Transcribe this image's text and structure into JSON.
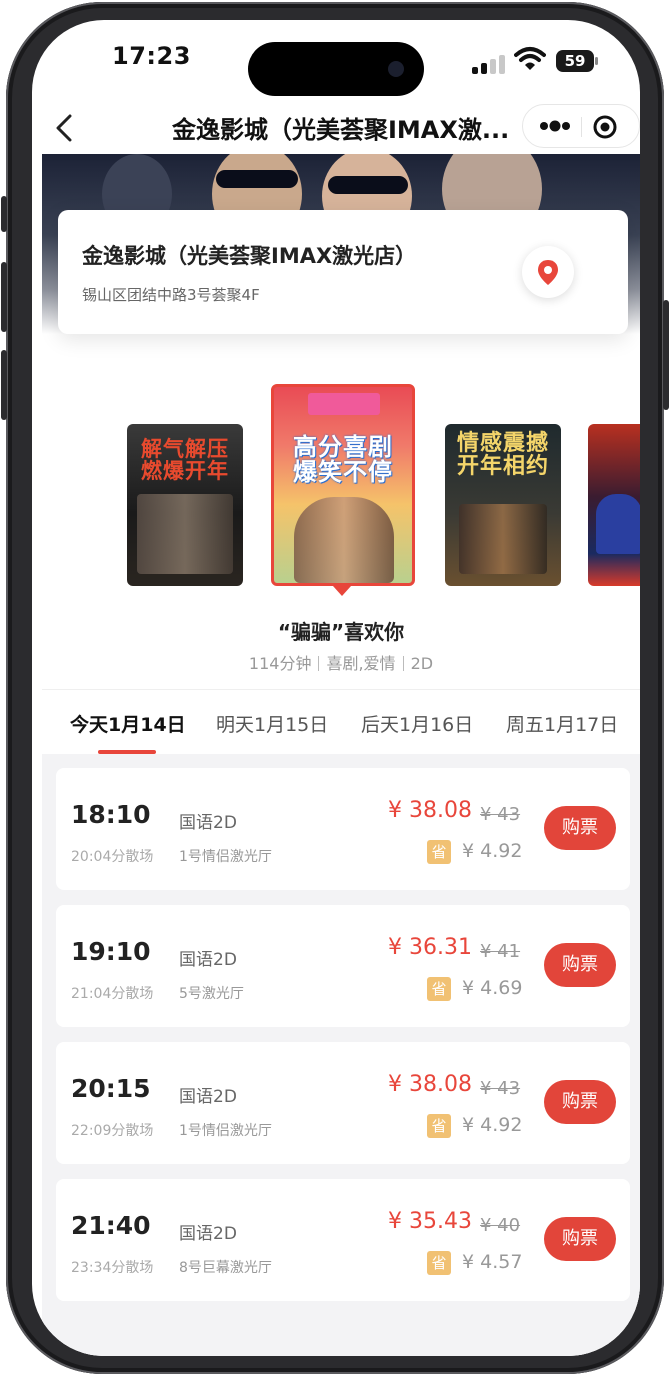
{
  "status": {
    "time": "17:23",
    "battery": "59"
  },
  "nav": {
    "title": "金逸影城（光美荟聚IMAX激...",
    "back_icon": "chevron-left-icon",
    "more_icon": "more-dots-icon",
    "target_icon": "target-icon"
  },
  "cinema": {
    "name": "金逸影城（光美荟聚IMAX激光店）",
    "address": "锡山区团结中路3号荟聚4F",
    "location_icon": "map-pin-icon"
  },
  "posters": [
    {
      "text": "解气解压\n燃爆开年",
      "color": "#e84a2e"
    },
    {
      "text": "高分喜剧\n爆笑不停",
      "color": "#ffffff"
    },
    {
      "text": "情感震撼\n开年相约",
      "color": "#f4d56a"
    },
    {
      "text": "",
      "color": "#ffffff"
    }
  ],
  "movie": {
    "title": "“骗骗”喜欢你",
    "duration": "114分钟",
    "genre": "喜剧,爱情",
    "format": "2D"
  },
  "tabs": [
    {
      "label": "今天1月14日",
      "active": true
    },
    {
      "label": "明天1月15日",
      "active": false
    },
    {
      "label": "后天1月16日",
      "active": false
    },
    {
      "label": "周五1月17日",
      "active": false
    }
  ],
  "showtimes": [
    {
      "time": "18:10",
      "end": "20:04分散场",
      "lang": "国语2D",
      "hall": "1号情侣激光厅",
      "price": "¥ 38.08",
      "original": "¥ 43",
      "save_badge": "省",
      "save": "¥ 4.92",
      "buy": "购票"
    },
    {
      "time": "19:10",
      "end": "21:04分散场",
      "lang": "国语2D",
      "hall": "5号激光厅",
      "price": "¥ 36.31",
      "original": "¥ 41",
      "save_badge": "省",
      "save": "¥ 4.69",
      "buy": "购票"
    },
    {
      "time": "20:15",
      "end": "22:09分散场",
      "lang": "国语2D",
      "hall": "1号情侣激光厅",
      "price": "¥ 38.08",
      "original": "¥ 43",
      "save_badge": "省",
      "save": "¥ 4.92",
      "buy": "购票"
    },
    {
      "time": "21:40",
      "end": "23:34分散场",
      "lang": "国语2D",
      "hall": "8号巨幕激光厅",
      "price": "¥ 35.43",
      "original": "¥ 40",
      "save_badge": "省",
      "save": "¥ 4.57",
      "buy": "购票"
    }
  ],
  "colors": {
    "accent": "#e8463b",
    "save_badge": "#f1c173",
    "list_bg": "#f3f3f5"
  }
}
